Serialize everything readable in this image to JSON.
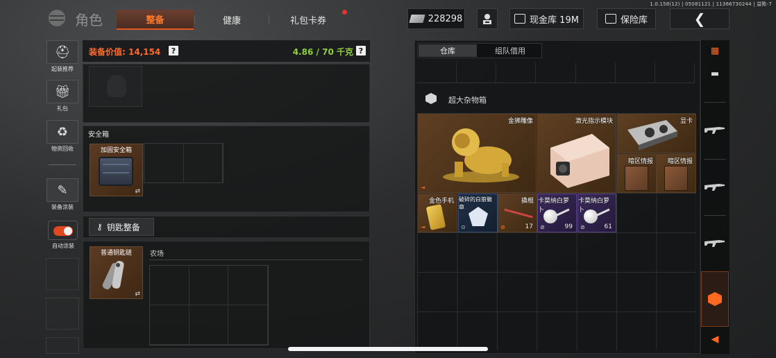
{
  "version": "1.0.158(12) | 05081121 | 11366730244 | 益陈-7",
  "header": {
    "title": "角色",
    "tabs": [
      {
        "label": "整备",
        "active": true
      },
      {
        "label": "健康",
        "active": false
      },
      {
        "label": "礼包卡券",
        "active": false,
        "badge": true
      }
    ],
    "money": "228298",
    "cash_vault_label": "现金库 19M",
    "safe_label": "保险库",
    "back_icon": "chevron-left-icon"
  },
  "sidebar": {
    "items": [
      {
        "label": "起装推荐",
        "icon": "loadout-icon"
      },
      {
        "label": "礼包",
        "icon": "gift-icon"
      },
      {
        "label": "物资回收",
        "icon": "recycle-icon"
      },
      {
        "label": "装备涂装",
        "icon": "paint-icon"
      }
    ],
    "toggle_label": "自动涂装",
    "toggle_on": true
  },
  "equipment": {
    "value_label": "装备价值: 14,154",
    "weight_label": "4.86 / 70 千克",
    "help": "?",
    "safebox_title": "安全箱",
    "safebox_item": "加固安全箱",
    "keychain_button": "钥匙整备",
    "keychain_item": "普通钥匙链",
    "farm_label": "农场",
    "swap_glyph": "⇄"
  },
  "storage": {
    "tabs": [
      {
        "label": "仓库",
        "active": true
      },
      {
        "label": "组队借用",
        "active": false
      }
    ],
    "category_title": "超大杂物箱",
    "items": {
      "lion": {
        "name": "金狮雕像",
        "color": "gold"
      },
      "laser": {
        "name": "激光指示模块",
        "color": "gold"
      },
      "gpu": {
        "name": "显卡",
        "color": "gold"
      },
      "intel1": {
        "name": "暗区情报",
        "color": "gold"
      },
      "intel2": {
        "name": "暗区情报",
        "color": "gold"
      },
      "goldphone": {
        "name": "金色手机",
        "color": "gold"
      },
      "badge": {
        "name": "破碎的白狼徽章",
        "color": "blue"
      },
      "crowbar": {
        "name": "撬棍",
        "count": "17",
        "color": "gold"
      },
      "carrot1": {
        "name": "卡莫纳白萝卜",
        "count": "99",
        "color": "purple"
      },
      "carrot2": {
        "name": "卡莫纳白萝卜",
        "count": "61",
        "color": "purple"
      }
    }
  },
  "colors": {
    "accent": "#ff6a2a",
    "weight_green": "#8fd13f",
    "gold_rarity": "#5e3f22",
    "purple_rarity": "#3b2a5a"
  }
}
